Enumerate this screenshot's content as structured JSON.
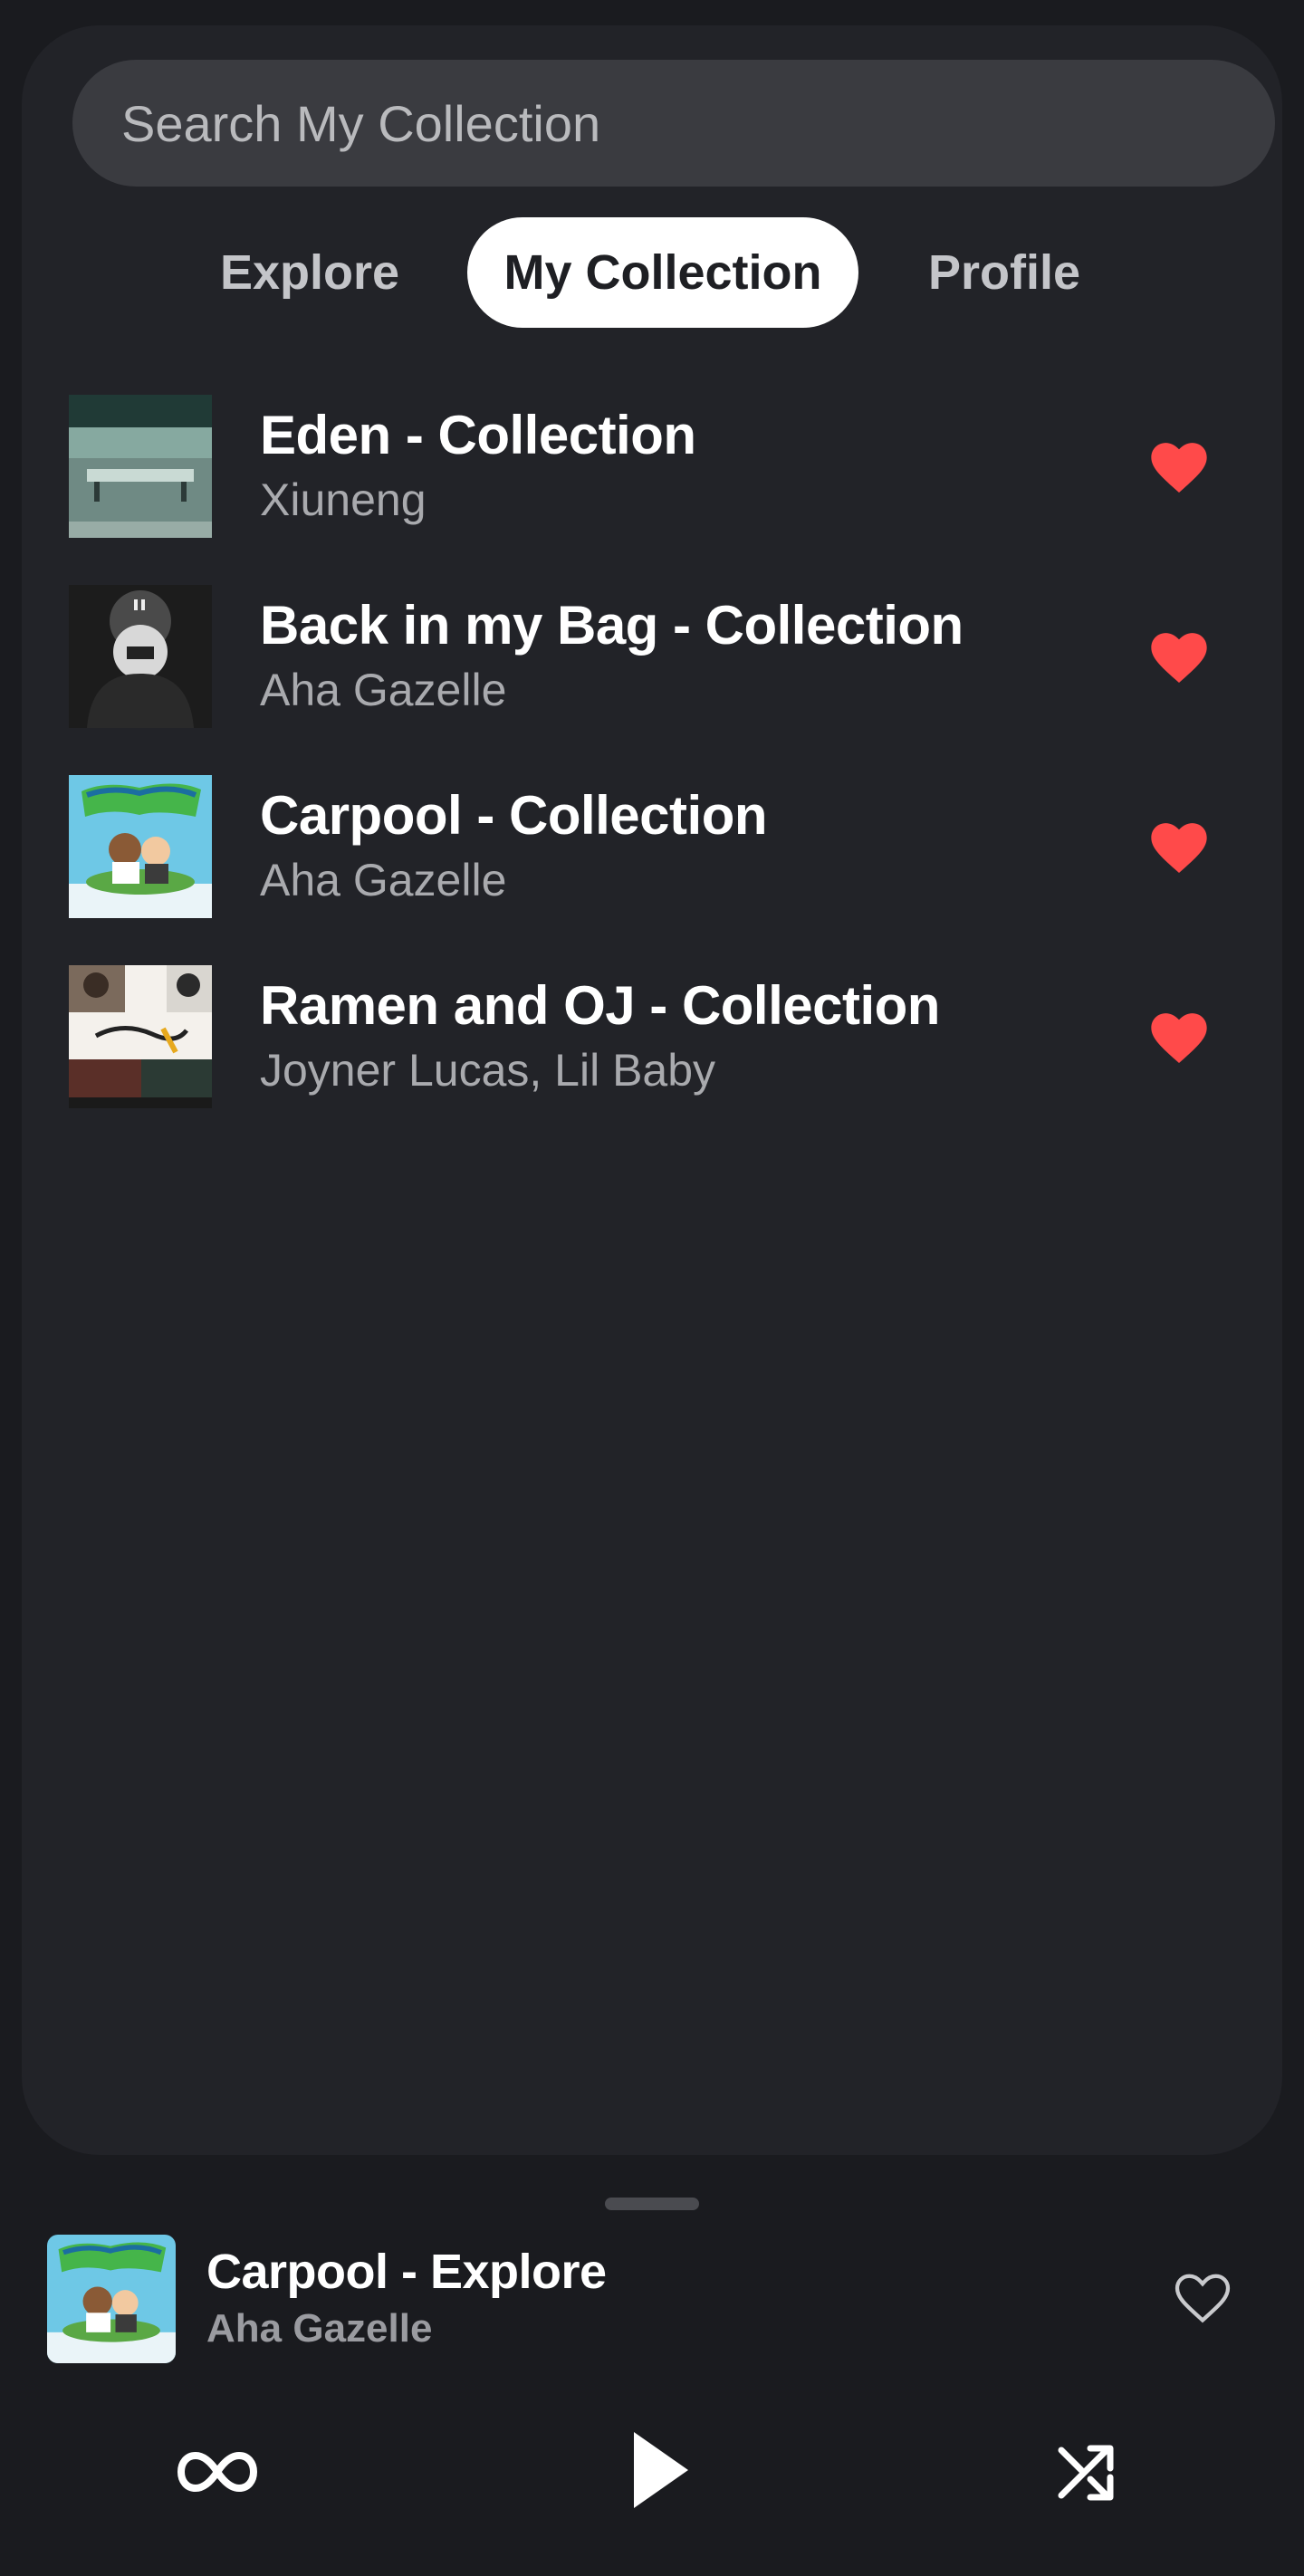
{
  "search": {
    "placeholder": "Search My Collection"
  },
  "tabs": [
    {
      "label": "Explore",
      "active": false
    },
    {
      "label": "My Collection",
      "active": true
    },
    {
      "label": "Profile",
      "active": false
    }
  ],
  "collection": [
    {
      "title": "Eden - Collection",
      "artist": "Xiuneng",
      "liked": true
    },
    {
      "title": "Back in my Bag - Collection",
      "artist": "Aha Gazelle",
      "liked": true
    },
    {
      "title": "Carpool - Collection",
      "artist": "Aha Gazelle",
      "liked": true
    },
    {
      "title": "Ramen and OJ - Collection",
      "artist": "Joyner Lucas, Lil Baby",
      "liked": true
    }
  ],
  "now_playing": {
    "title": "Carpool - Explore",
    "artist": "Aha Gazelle",
    "liked": false
  },
  "controls": {
    "repeat_icon": "infinity-icon",
    "play_icon": "play-icon",
    "shuffle_icon": "shuffle-icon"
  },
  "colors": {
    "background": "#1a1b1f",
    "panel": "#222328",
    "search_bg": "#3a3b40",
    "heart_liked": "#ff4a4a",
    "active_tab_bg": "#ffffff",
    "secondary_text": "#a9aaae"
  }
}
